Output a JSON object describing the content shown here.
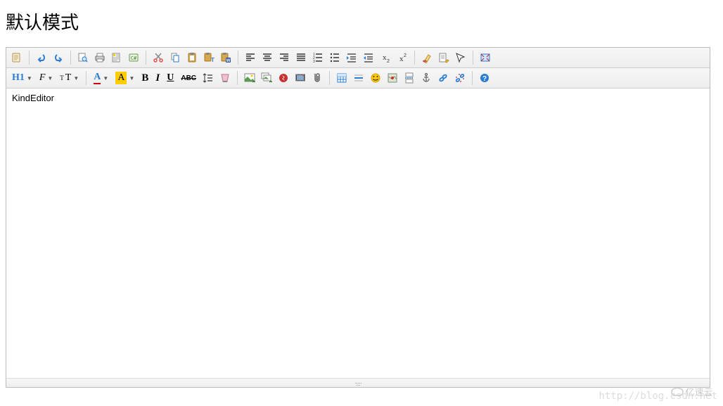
{
  "title": "默认模式",
  "content_text": "KindEditor",
  "watermark": "http://blog.csdn.net",
  "heading_label": "H1",
  "font_label": "F",
  "size_label": "T",
  "color_label": "A",
  "bold_label": "B",
  "italic_label": "I",
  "underline_label": "U",
  "strike_label": "ABC",
  "logo_text": "亿速云"
}
